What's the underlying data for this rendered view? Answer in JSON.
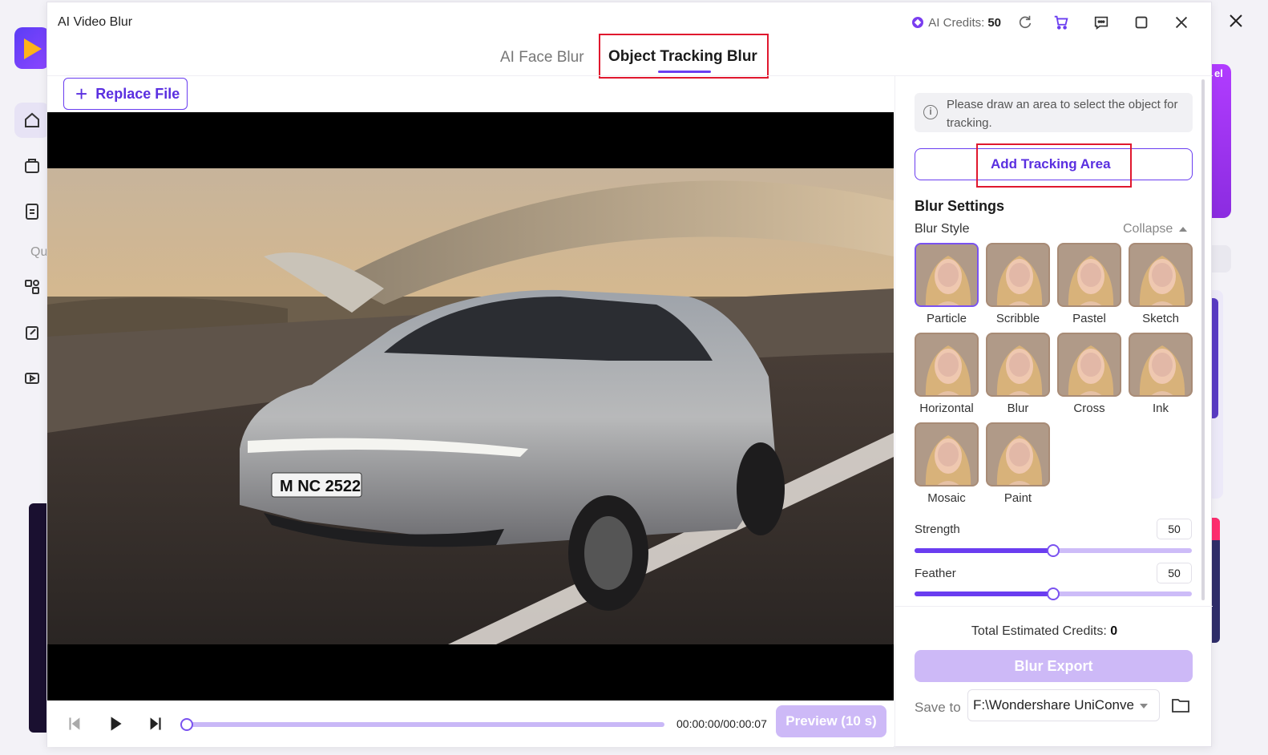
{
  "window": {
    "title": "AI Video Blur",
    "credits_label": "AI Credits:",
    "credits_value": "50"
  },
  "tabs": [
    {
      "label": "AI Face Blur",
      "active": false
    },
    {
      "label": "Object Tracking Blur",
      "active": true
    }
  ],
  "toolbar": {
    "replace_label": "Replace File"
  },
  "player": {
    "time": "00:00:00/00:00:07",
    "preview_label": "Preview (10 s)",
    "progress": 0,
    "plate_text": "M NC 2522"
  },
  "panel": {
    "hint": "Please draw an area to select the object for tracking.",
    "add_tracking_label": "Add Tracking Area",
    "settings_title": "Blur Settings",
    "style_label": "Blur Style",
    "collapse_label": "Collapse",
    "styles": [
      {
        "label": "Particle",
        "selected": true
      },
      {
        "label": "Scribble",
        "selected": false
      },
      {
        "label": "Pastel",
        "selected": false
      },
      {
        "label": "Sketch",
        "selected": false
      },
      {
        "label": "Horizontal",
        "selected": false
      },
      {
        "label": "Blur",
        "selected": false
      },
      {
        "label": "Cross",
        "selected": false
      },
      {
        "label": "Ink",
        "selected": false
      },
      {
        "label": "Mosaic",
        "selected": false
      },
      {
        "label": "Paint",
        "selected": false
      }
    ],
    "strength": {
      "label": "Strength",
      "value": "50",
      "fraction": 0.5
    },
    "feather": {
      "label": "Feather",
      "value": "50",
      "fraction": 0.5
    },
    "total_label": "Total Estimated Credits:",
    "total_value": "0",
    "export_label": "Blur  Export",
    "save_label": "Save to",
    "save_path": "F:\\Wondershare UniConve"
  },
  "background": {
    "q_label": "Qu",
    "tag_text": "el"
  },
  "colors": {
    "accent": "#6a3df0",
    "highlight": "#e0182e",
    "disabled": "#cdb9f7"
  }
}
